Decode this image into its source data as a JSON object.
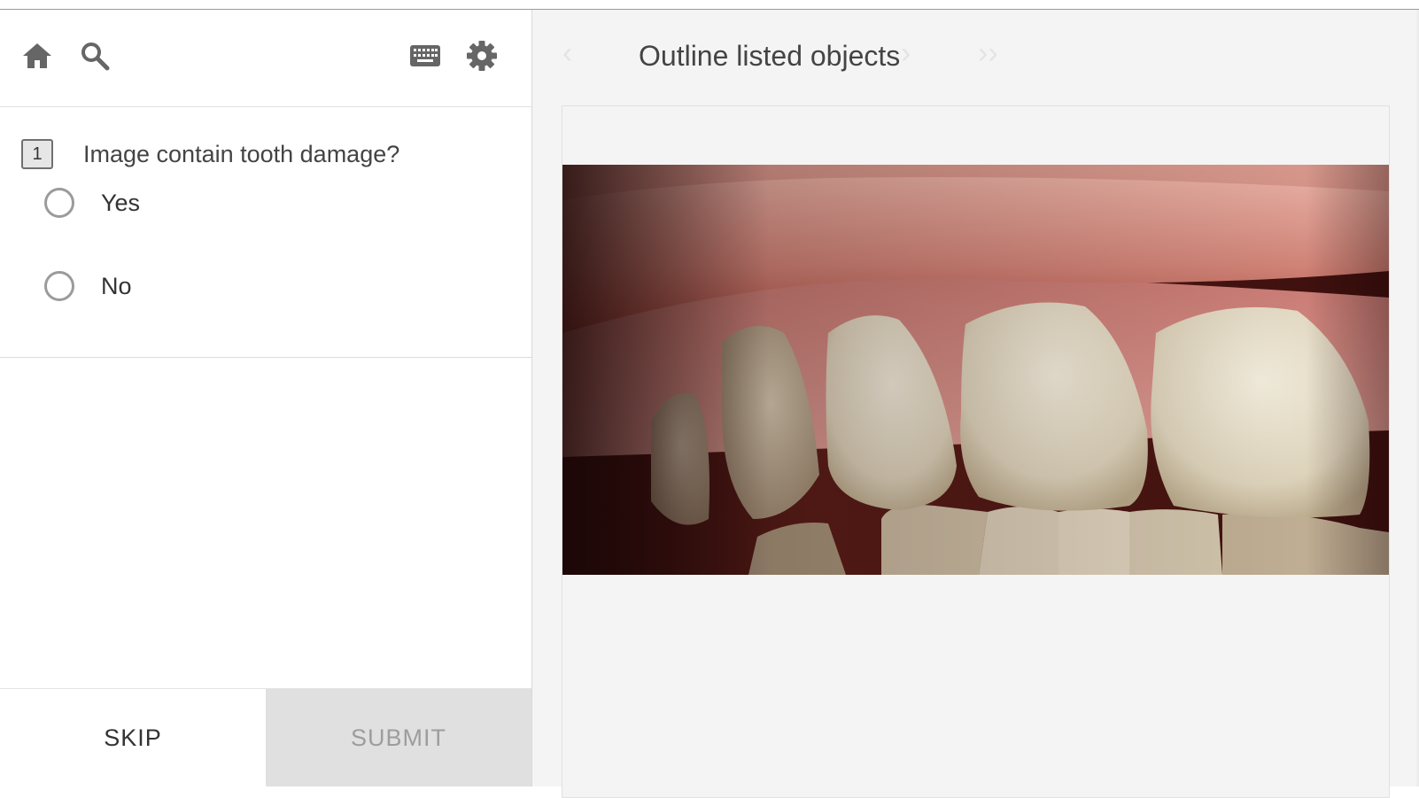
{
  "toolbar": {
    "icons": [
      "home-icon",
      "search-icon",
      "keyboard-icon",
      "gear-icon"
    ]
  },
  "question": {
    "number": "1",
    "text": "Image contain tooth damage?",
    "options": [
      {
        "label": "Yes",
        "selected": false
      },
      {
        "label": "No",
        "selected": false
      }
    ]
  },
  "buttons": {
    "skip_label": "SKIP",
    "submit_label": "SUBMIT"
  },
  "header": {
    "title": "Outline listed objects",
    "prev_glyph": "‹",
    "next_glyph": "›",
    "last_glyph": "››"
  },
  "colors": {
    "submit_bg": "#e0e0e0",
    "panel_bg": "#f4f4f4"
  }
}
